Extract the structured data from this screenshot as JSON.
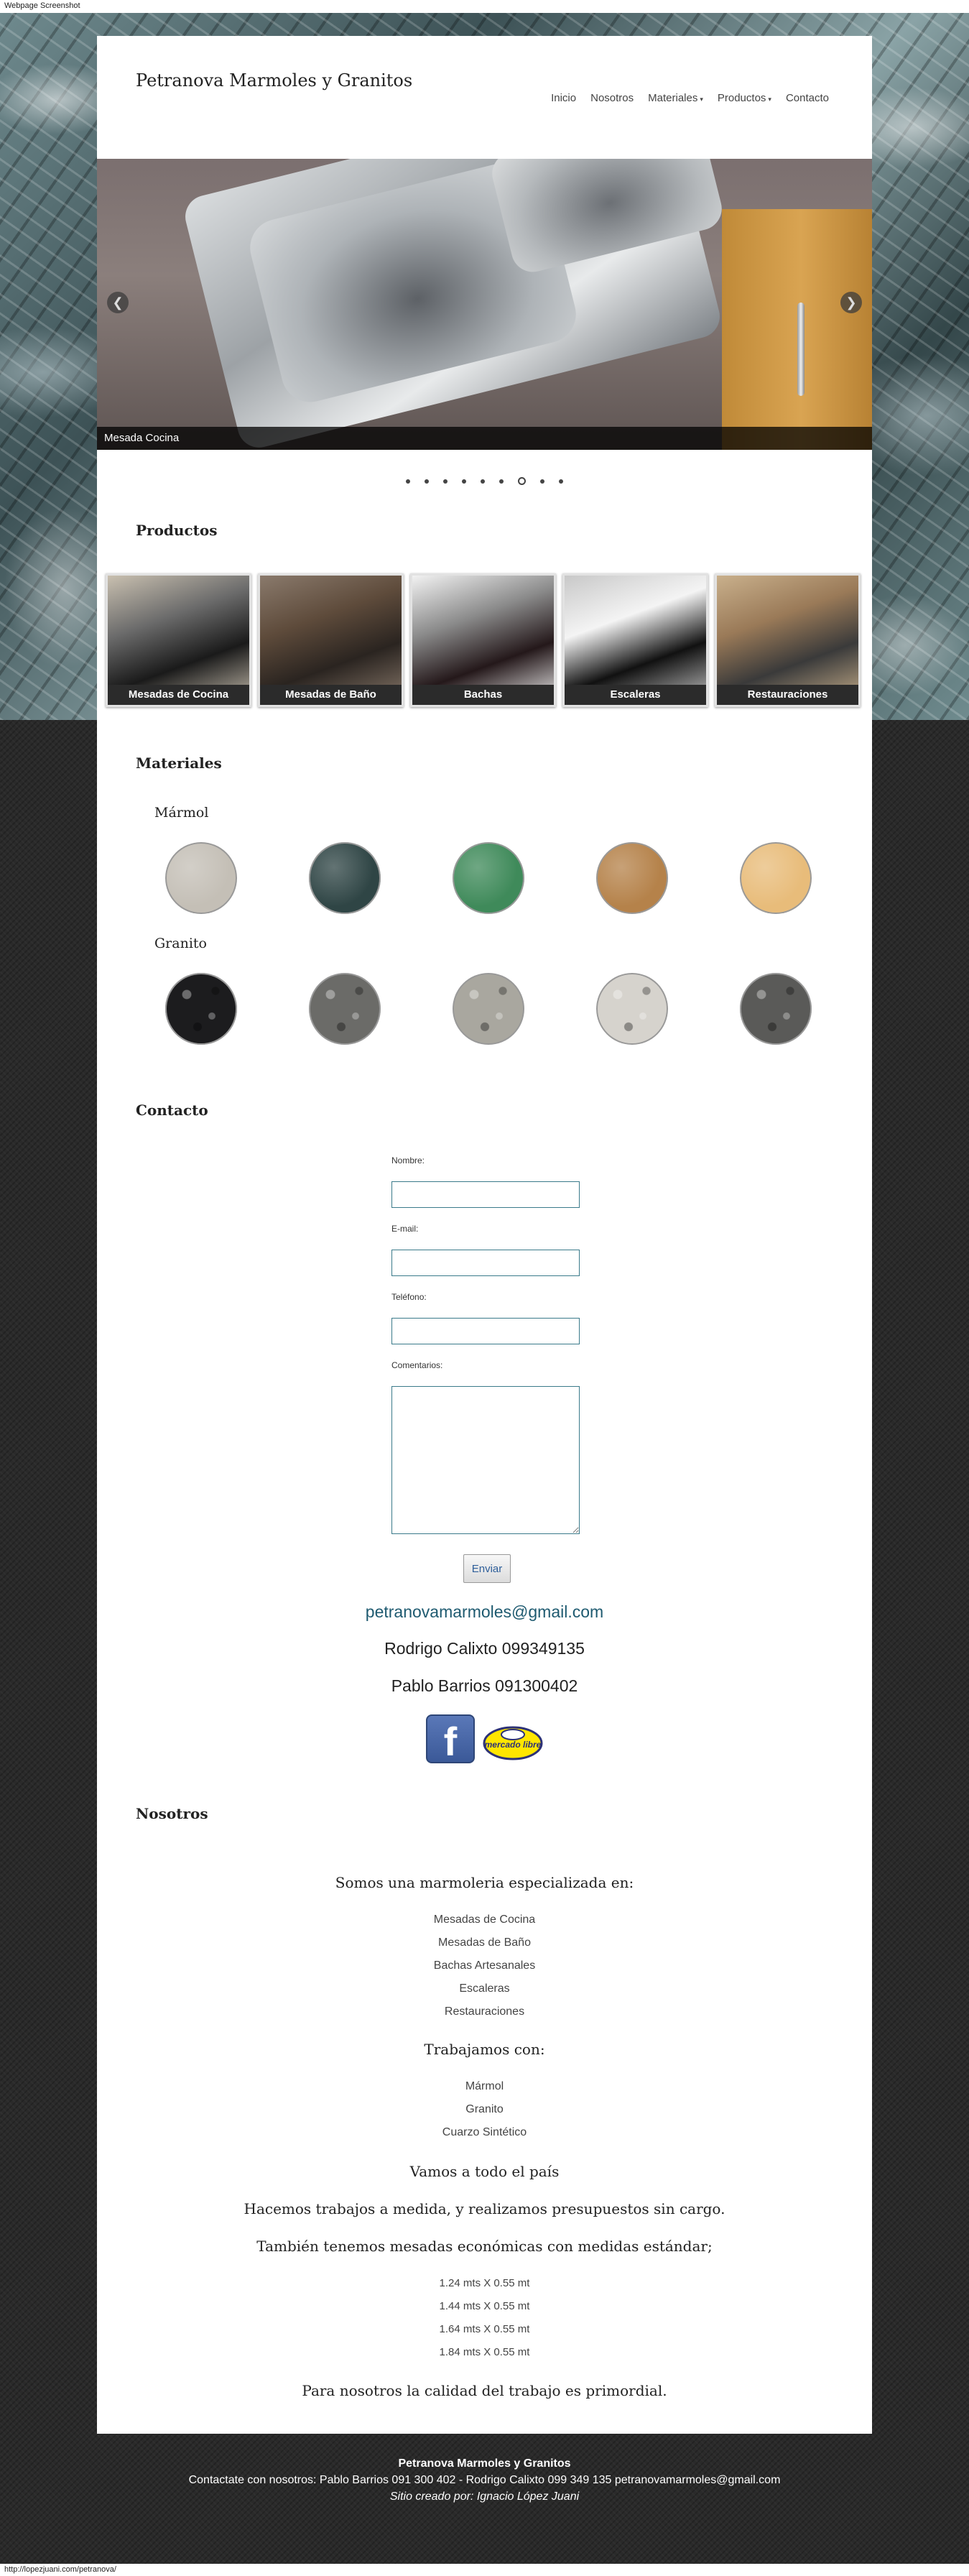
{
  "capture": {
    "header": "Webpage Screenshot",
    "url": "http://lopezjuani.com/petranova/"
  },
  "site": {
    "title": "Petranova Marmoles y Granitos"
  },
  "nav": {
    "items": [
      {
        "label": "Inicio"
      },
      {
        "label": "Nosotros"
      },
      {
        "label": "Materiales",
        "has_dropdown": true
      },
      {
        "label": "Productos",
        "has_dropdown": true
      },
      {
        "label": "Contacto"
      }
    ],
    "caret_glyph": "▾"
  },
  "slider": {
    "caption": "Mesada Cocina",
    "prev_glyph": "❮",
    "next_glyph": "❯",
    "dot_count": 9,
    "active_dot": 6
  },
  "productos": {
    "heading": "Productos",
    "items": [
      {
        "label": "Mesadas de Cocina",
        "colors": [
          "#6b6b6b",
          "#1a1a1a",
          "#c9c0b0"
        ]
      },
      {
        "label": "Mesadas de Baño",
        "colors": [
          "#5e4b3b",
          "#2a2420",
          "#8a7a6c"
        ]
      },
      {
        "label": "Bachas",
        "colors": [
          "#8a8a8a",
          "#24181a",
          "#f2f2f2"
        ]
      },
      {
        "label": "Escaleras",
        "colors": [
          "#f4f4f4",
          "#111111",
          "#c8c8c8"
        ]
      },
      {
        "label": "Restauraciones",
        "colors": [
          "#9a7a58",
          "#3a3a3a",
          "#c9b08c"
        ]
      }
    ]
  },
  "materiales": {
    "heading": "Materiales",
    "marmol": {
      "label": "Mármol",
      "swatches": [
        {
          "name": "marmol-gris-claro",
          "color": "#c4bfb6"
        },
        {
          "name": "marmol-verde-oscuro",
          "color": "#2f4545"
        },
        {
          "name": "marmol-verde",
          "color": "#3f8a5a"
        },
        {
          "name": "marmol-travertino",
          "color": "#b5824a"
        },
        {
          "name": "marmol-crema",
          "color": "#e8bc7a"
        }
      ]
    },
    "granito": {
      "label": "Granito",
      "swatches": [
        {
          "name": "granito-negro",
          "color": "#1c1c1e"
        },
        {
          "name": "granito-gris-oscuro",
          "color": "#6b6b68"
        },
        {
          "name": "granito-gris",
          "color": "#a9a79f"
        },
        {
          "name": "granito-blanco",
          "color": "#d6d3cd"
        },
        {
          "name": "granito-sal-y-pimienta",
          "color": "#5a5a58"
        }
      ]
    }
  },
  "contacto": {
    "heading": "Contacto",
    "fields": {
      "nombre": {
        "label": "Nombre:",
        "value": ""
      },
      "email": {
        "label": "E-mail:",
        "value": ""
      },
      "telefono": {
        "label": "Teléfono:",
        "value": ""
      },
      "comentarios": {
        "label": "Comentarios:",
        "value": ""
      }
    },
    "send_label": "Enviar",
    "email": "petranovamarmoles@gmail.com",
    "phone_1": "Rodrigo Calixto 099349135",
    "phone_2": "Pablo Barrios 091300402",
    "mercadolibre_text": "mercado libre"
  },
  "nosotros": {
    "heading": "Nosotros",
    "intro": "Somos una marmoleria especializada en:",
    "especialidades": [
      "Mesadas de Cocina",
      "Mesadas de Baño",
      "Bachas Artesanales",
      "Escaleras",
      "Restauraciones"
    ],
    "trabajamos_title": "Trabajamos con:",
    "materiales": [
      "Mármol",
      "Granito",
      "Cuarzo Sintético"
    ],
    "pais": "Vamos a todo el país",
    "medida": "Hacemos trabajos a medida, y realizamos presupuestos sin cargo.",
    "estandar": "También tenemos mesadas económicas con medidas estándar;",
    "medidas": [
      "1.24 mts X 0.55 mt",
      "1.44 mts X 0.55 mt",
      "1.64 mts X 0.55 mt",
      "1.84 mts X 0.55 mt"
    ],
    "calidad": "Para nosotros la calidad del trabajo es primordial."
  },
  "footer": {
    "title": "Petranova Marmoles y Granitos",
    "contact": "Contactate con nosotros: Pablo Barrios 091 300 402 - Rodrigo Calixto 099 349 135 petranovamarmoles@gmail.com",
    "credit_prefix": "Sitio creado por: ",
    "credit_name": "Ignacio López Juani"
  }
}
